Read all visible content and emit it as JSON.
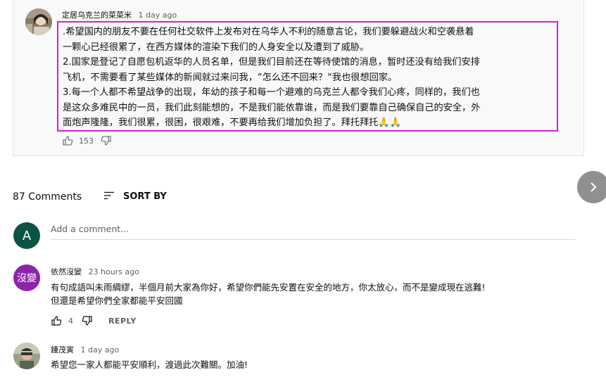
{
  "top_comment": {
    "author": "定居乌克兰的菜菜米",
    "time": "1 day ago",
    "lines": [
      ".希望国内的朋友不要在任何社交软件上发布对在乌华人不利的随意言论，我们要躲避战火和空袭悬着",
      "一颗心已经很累了，在西方媒体的渲染下我们的人身安全以及遭到了威胁。",
      "2.国家是登记了自愿包机返华的人员名单，但是我们目前还在等待使馆的消息，暂时还没有给我们安排",
      "飞机，不需要看了某些媒体的新闻就过来问我，“怎么还不回来？“我也很想回家。",
      "3.每一个人都不希望战争的出现，年幼的孩子和每一个避难的乌克兰人都令我们心疼，同样的，我们也",
      "是这众多难民中的一员，我们此刻能想的，不是我们能依靠谁，而是我们要靠自己确保自己的安全，外",
      "面炮声隆隆，我们很累，很困，很艰难，不要再给我们增加负担了。拜托拜托🙏🙏"
    ],
    "likes": "153"
  },
  "comments_header": {
    "count": "87 Comments",
    "sort_label": "SORT BY"
  },
  "add_comment": {
    "avatar_letter": "A",
    "placeholder": "Add a comment..."
  },
  "comments": [
    {
      "author": "依然沒變",
      "avatar_text": "沒變",
      "time": "23 hours ago",
      "lines": [
        "有句成語叫未雨綢繆，半個月前大家為你好，希望你們能先安置在安全的地方，你太放心，而不是變成現在逃難!",
        "但還是希望你們全家都能平安回國"
      ],
      "likes": "4",
      "reply_label": "REPLY"
    },
    {
      "author": "鍾茂寅",
      "time": "1 day ago",
      "lines": [
        "希望您一家人都能平安順利，渡過此次難關。加油!"
      ]
    }
  ]
}
